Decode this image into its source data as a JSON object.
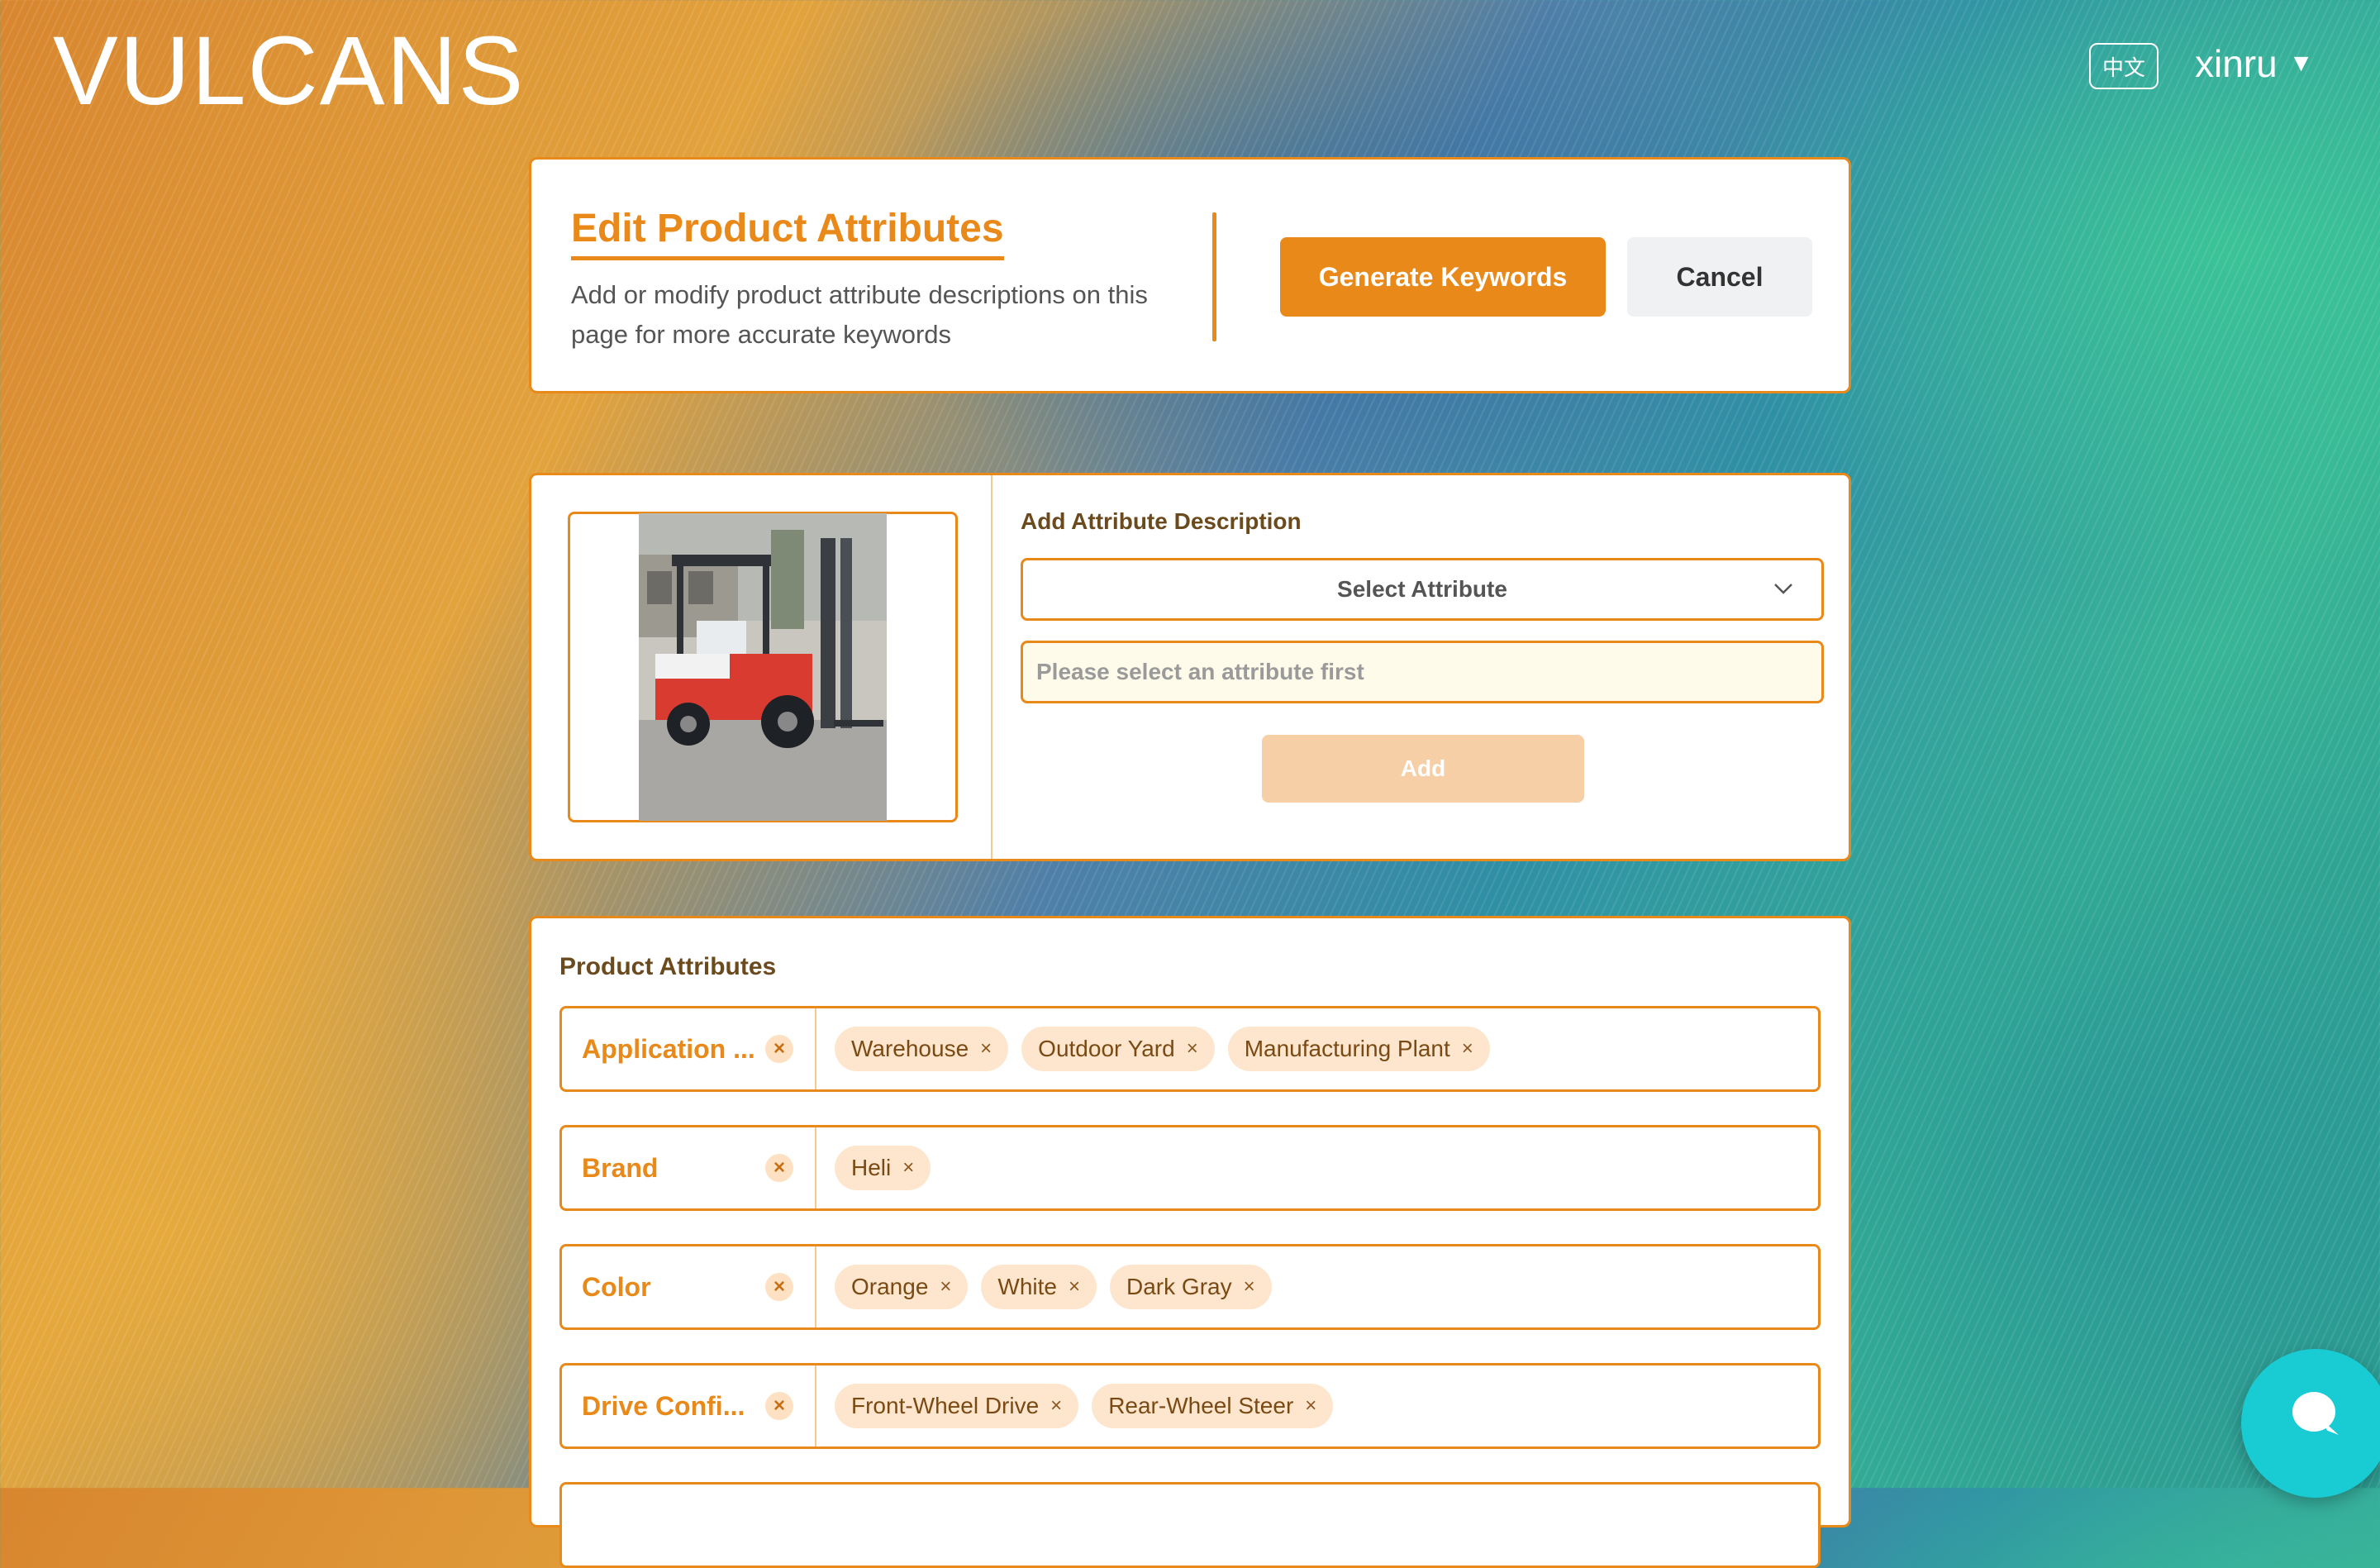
{
  "header": {
    "logo": "VULCANS",
    "lang_button": "中文",
    "user_name": "xinru",
    "user_caret": "▼"
  },
  "edit_card": {
    "title": "Edit Product Attributes",
    "subtitle": "Add or modify product attribute descriptions on this page for more accurate keywords",
    "generate_label": "Generate Keywords",
    "cancel_label": "Cancel"
  },
  "add_card": {
    "section_label": "Add Attribute Description",
    "select_value": "Select Attribute",
    "input_placeholder": "Please select an attribute first",
    "add_label": "Add",
    "image_icon": "forklift-product-photo"
  },
  "attributes": {
    "title": "Product Attributes",
    "remove_icon": "×",
    "rows": [
      {
        "name": "Application ...",
        "tags": [
          "Warehouse",
          "Outdoor Yard",
          "Manufacturing Plant"
        ]
      },
      {
        "name": "Brand",
        "tags": [
          "Heli"
        ]
      },
      {
        "name": "Color",
        "tags": [
          "Orange",
          "White",
          "Dark Gray"
        ]
      },
      {
        "name": "Drive Confi...",
        "tags": [
          "Front-Wheel Drive",
          "Rear-Wheel Steer"
        ]
      }
    ]
  },
  "colors": {
    "accent": "#e8891a",
    "chat": "#19cbd3"
  },
  "chat": {
    "icon": "chat-bubble-icon"
  }
}
